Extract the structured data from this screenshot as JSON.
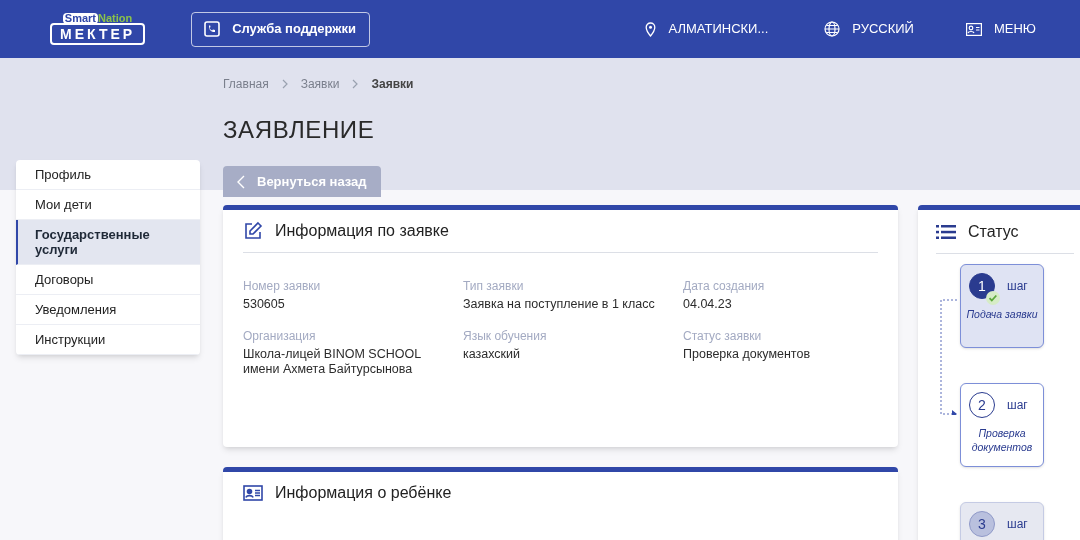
{
  "header": {
    "logo_top_left": "Smart",
    "logo_top_right": "Nation",
    "logo_main": "МЕКТЕР",
    "support_button": "Служба поддержки",
    "region": "АЛМАТИНСКИ...",
    "language": "РУССКИЙ",
    "menu": "МЕНЮ"
  },
  "breadcrumbs": [
    {
      "label": "Главная",
      "current": false
    },
    {
      "label": "Заявки",
      "current": false
    },
    {
      "label": "Заявки",
      "current": true
    }
  ],
  "page_title": "ЗАЯВЛЕНИЕ",
  "back_button": "Вернуться назад",
  "sidebar": {
    "items": [
      {
        "label": "Профиль",
        "selected": false
      },
      {
        "label": "Мои дети",
        "selected": false
      },
      {
        "label": "Государственные услуги",
        "selected": true
      },
      {
        "label": "Договоры",
        "selected": false
      },
      {
        "label": "Уведомления",
        "selected": false
      },
      {
        "label": "Инструкции",
        "selected": false
      }
    ]
  },
  "application_card": {
    "title": "Информация по заявке",
    "fields": [
      {
        "label": "Номер заявки",
        "value": "530605"
      },
      {
        "label": "Тип заявки",
        "value": "Заявка на поступление в 1 класс"
      },
      {
        "label": "Дата создания",
        "value": "04.04.23"
      },
      {
        "label": "Организация",
        "value": "Школа-лицей BINOM SCHOOL имени Ахмета Байтурсынова"
      },
      {
        "label": "Язык обучения",
        "value": "казахский"
      },
      {
        "label": "Статус заявки",
        "value": "Проверка документов"
      }
    ]
  },
  "child_card": {
    "title": "Информация о ребёнке"
  },
  "status": {
    "title": "Статус",
    "steps": [
      {
        "number": "1",
        "word": "шаг",
        "label": "Подача заявки",
        "kind": "done"
      },
      {
        "number": "2",
        "word": "шаг",
        "label": "Проверка документов",
        "kind": "current"
      },
      {
        "number": "3",
        "word": "шаг",
        "kind": "pending"
      }
    ]
  }
}
